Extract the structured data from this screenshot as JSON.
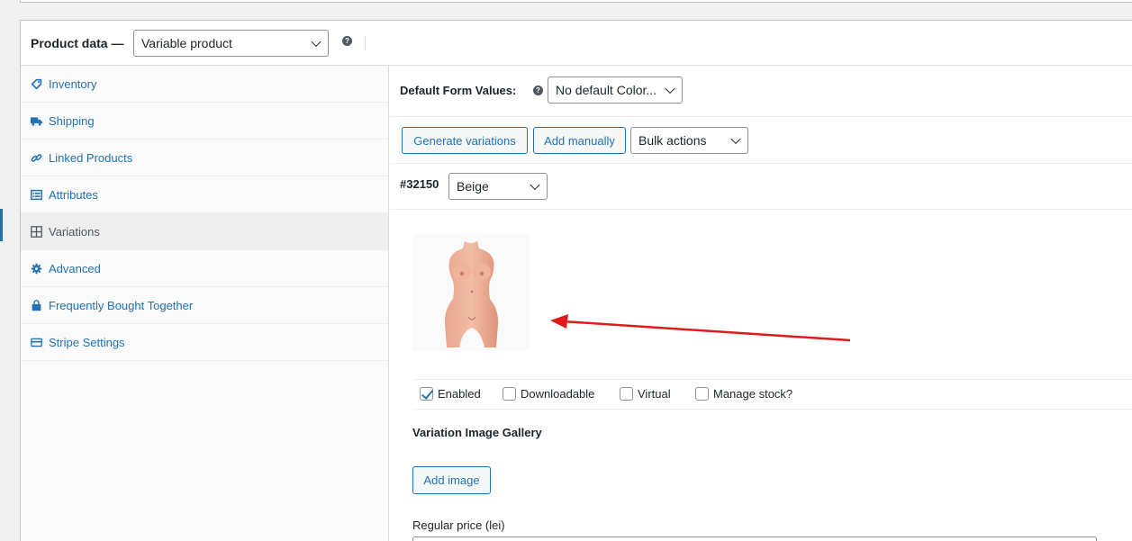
{
  "header": {
    "title": "Product data —",
    "product_type": "Variable product",
    "help_glyph": "?"
  },
  "tabs": [
    {
      "label": "Inventory",
      "icon": "tag-icon"
    },
    {
      "label": "Shipping",
      "icon": "truck-icon"
    },
    {
      "label": "Linked Products",
      "icon": "link-icon"
    },
    {
      "label": "Attributes",
      "icon": "list-icon"
    },
    {
      "label": "Variations",
      "icon": "grid-icon",
      "active": true
    },
    {
      "label": "Advanced",
      "icon": "gear-icon"
    },
    {
      "label": "Frequently Bought Together",
      "icon": "bag-icon"
    },
    {
      "label": "Stripe Settings",
      "icon": "card-icon"
    }
  ],
  "variations": {
    "default_form_label": "Default Form Values:",
    "default_form_value": "No default Color...",
    "generate_label": "Generate variations",
    "add_manually_label": "Add manually",
    "bulk_actions_label": "Bulk actions",
    "variation_id": "#32150",
    "variation_color": "Beige",
    "options": {
      "enabled": "Enabled",
      "downloadable": "Downloadable",
      "virtual": "Virtual",
      "manage_stock": "Manage stock?"
    },
    "enabled_checked": true,
    "gallery_label": "Variation Image Gallery",
    "add_image_label": "Add image",
    "regular_price_label": "Regular price (lei)"
  },
  "colors": {
    "accent": "#2271b1",
    "arrow": "#e01b1b"
  }
}
